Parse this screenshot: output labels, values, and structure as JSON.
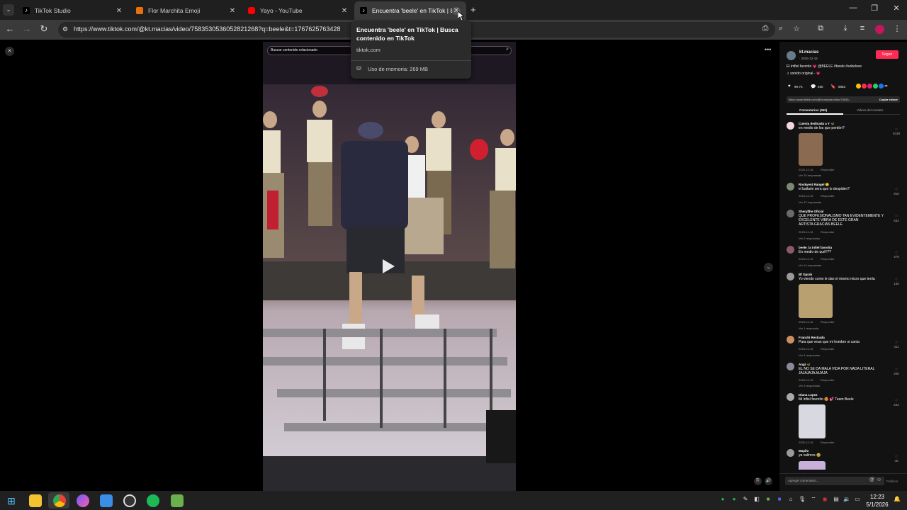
{
  "tabs": [
    {
      "title": "TikTok Studio",
      "active": false
    },
    {
      "title": "Flor Marchita Emoji",
      "active": false
    },
    {
      "title": "Yayo - YouTube",
      "active": false
    },
    {
      "title": "Encuentra 'beele' en TikTok | Bu",
      "active": true
    }
  ],
  "address": {
    "url": "https://www.tiktok.com/@kt.macias/video/7583530536052821268?q=beele&t=1767625763428"
  },
  "tab_popup": {
    "title": "Encuentra 'beele' en TikTok | Busca contenido en TikTok",
    "domain": "tiktok.com",
    "memory": "Uso de memoria: 269 MB"
  },
  "video": {
    "search_placeholder": "Buscar contenido relacionado"
  },
  "post": {
    "username": "kt.macias",
    "date": "· 2025-12-15",
    "follow_label": "Seguir",
    "caption": "El intfiel favorito 💗 @BEELE #beele #sobelove",
    "sound": "♫ sonido original - 💗",
    "likes": "99.7K",
    "comments": "460",
    "saves": "6853",
    "link": "https://www.tiktok.com/@kt.macias/video/75835...",
    "copy_label": "Copiar enlace",
    "tab_comments": "Comentarios (460)",
    "tab_videos": "Videos del creador"
  },
  "comments": [
    {
      "name": "Cuenta dedicada a Y 🦋",
      "text": "en medio de los que perdón?",
      "date": "2025-12-16",
      "reply": "Responder",
      "more": "Ver 20 respuestas",
      "likes": "4039",
      "has_image": true
    },
    {
      "name": "Rockyent Rangel 🙂",
      "text": "el bailarin sera que lo despiden?",
      "date": "2025-12-15",
      "reply": "Responder",
      "more": "Ver 37 respuestas",
      "likes": "916",
      "has_image": false
    },
    {
      "name": "Sheryllhe Oficial",
      "text": "QUE PROFESIONALISMO TAN EVIDENTEMENTE Y EXCELENTE VIBRA DE ESTE GRAN ARTISTA.GRACIAS BEELE",
      "date": "2025-12-16",
      "reply": "Responder",
      "more": "Ver 2 respuestas",
      "likes": "632",
      "has_image": false
    },
    {
      "name": "beele_la infiel favorita",
      "text": "En medio de qué!!??",
      "date": "2025-12-15",
      "reply": "Responder",
      "more": "Ver 14 respuestas",
      "likes": "475",
      "has_image": false
    },
    {
      "name": "Bf Oprah",
      "text": "Yo viendo como le dan el mismo micro que tenía",
      "date": "2025-12-16",
      "reply": "Responder",
      "more": "Ver 1 respuesta",
      "likes": "136",
      "has_image": true
    },
    {
      "name": "Franchi Restrada",
      "text": "Para que vean que mi hombre si canta",
      "date": "2025-12-16",
      "reply": "Responder",
      "more": "Ver 4 respuestas",
      "likes": "411",
      "has_image": false
    },
    {
      "name": "Angi 🦋",
      "text": "EL NO SE DA MALA VIDA POR NADA LITERAL JAJAJAJAJAJAJA",
      "date": "2025-12-16",
      "reply": "Responder",
      "more": "Ver 3 respuestas",
      "likes": "205",
      "has_image": false
    },
    {
      "name": "Diana Lopez",
      "text": "Mi infiel favorito 😍 💕 Team Beele",
      "date": "2025-12-16",
      "reply": "Responder",
      "more": "",
      "likes": "242",
      "has_image": true
    },
    {
      "name": "Mapilo",
      "text": "ya valimos 😂",
      "date": "",
      "reply": "",
      "more": "",
      "likes": "40",
      "has_image": true
    }
  ],
  "comment_input": {
    "placeholder": "Agregar comentario...",
    "post_label": "Publicar"
  },
  "clock": {
    "time": "12:23",
    "date": "5/1/2026"
  },
  "colors": {
    "tiktok_red": "#fe2c55",
    "chrome_dark": "#1f1f1f",
    "toolbar": "#3a3a3a"
  }
}
